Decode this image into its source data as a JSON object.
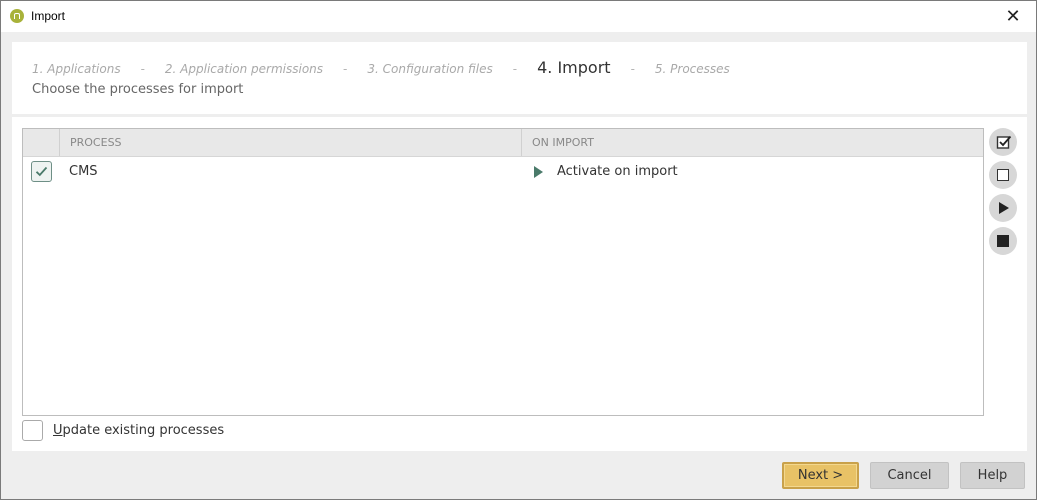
{
  "window": {
    "title": "Import",
    "close_glyph": "✕"
  },
  "wizard": {
    "steps": [
      {
        "label": "1. Applications",
        "active": false
      },
      {
        "label": "2. Application permissions",
        "active": false
      },
      {
        "label": "3. Configuration files",
        "active": false
      },
      {
        "label": "4. Import",
        "active": true
      },
      {
        "label": "5. Processes",
        "active": false
      }
    ],
    "separator": "-",
    "subtitle": "Choose the processes for import"
  },
  "table": {
    "columns": {
      "process": "PROCESS",
      "on_import": "ON IMPORT"
    },
    "rows": [
      {
        "checked": true,
        "process": "CMS",
        "on_import": "Activate on import"
      }
    ]
  },
  "side_tools": [
    {
      "name": "select-all-icon"
    },
    {
      "name": "deselect-all-icon"
    },
    {
      "name": "play-icon"
    },
    {
      "name": "stop-icon"
    }
  ],
  "update_existing": {
    "checked": false,
    "label_mnemonic": "U",
    "label_rest": "pdate existing processes"
  },
  "footer": {
    "next": "Next >",
    "cancel": "Cancel",
    "help": "Help"
  },
  "colors": {
    "accent_next": "#e8c266",
    "check_green": "#4a7a6a",
    "app_icon": "#a8b23a"
  }
}
